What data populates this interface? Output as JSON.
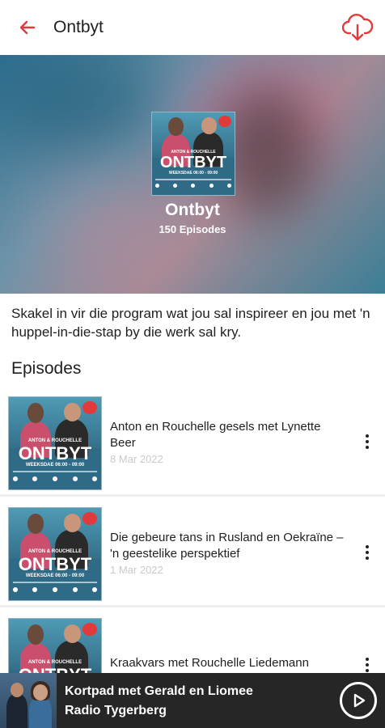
{
  "appbar": {
    "title": "Ontbyt",
    "accent": "#e23a3a"
  },
  "hero": {
    "cover_brand": "ONTBYT",
    "cover_hosts": "ANTON & ROUCHELLE",
    "cover_time": "WEEKSDAE 06:00 - 09:00",
    "title": "Ontbyt",
    "episode_count": "150 Episodes"
  },
  "description": "Skakel in vir die program wat jou sal inspireer en jou met 'n huppel-in-die-stap by die werk sal kry.",
  "episodes_section": {
    "title": "Episodes"
  },
  "episodes": [
    {
      "title": "Anton en Rouchelle gesels met Lynette Beer",
      "date": "8 Mar 2022"
    },
    {
      "title": "Die gebeure tans in Rusland en Oekraïne – 'n geestelike perspektief",
      "date": "1 Mar 2022"
    },
    {
      "title": "Kraakvars met Rouchelle Liedemann",
      "date": ""
    }
  ],
  "player": {
    "title": "Kortpad met Gerald en Liomee",
    "station": "Radio Tygerberg"
  },
  "icons": {
    "back": "arrow-left-icon",
    "download": "cloud-download-icon",
    "more": "more-vertical-icon",
    "play": "play-icon"
  }
}
